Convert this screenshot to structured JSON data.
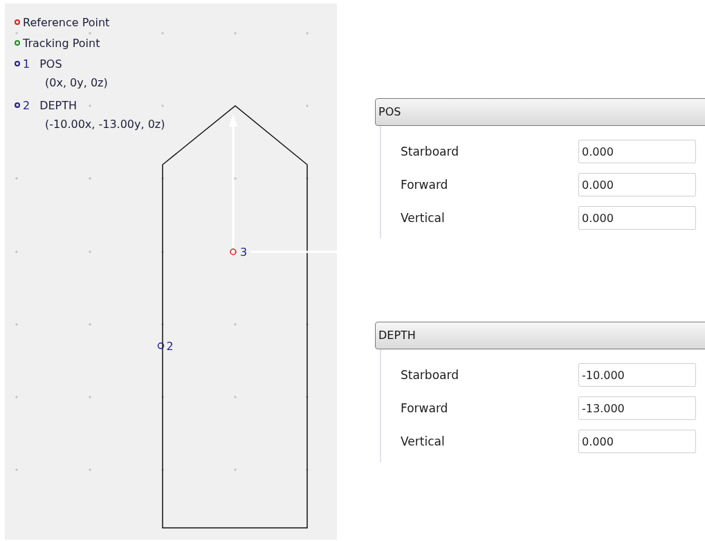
{
  "legend": [
    {
      "kind": "reference",
      "label": "Reference Point",
      "color": "#e02020"
    },
    {
      "kind": "tracking",
      "label": "Tracking Point",
      "color": "#209020"
    },
    {
      "kind": "point",
      "number": "1",
      "label": "POS",
      "coords": "(0x, 0y, 0z)",
      "color": "#20208c"
    },
    {
      "kind": "point",
      "number": "2",
      "label": "DEPTH",
      "coords": "(-10.00x, -13.00y, 0z)",
      "color": "#20208c"
    }
  ],
  "canvas": {
    "reference_marker": {
      "label": "3",
      "color": "#e02020"
    }
  },
  "panels": [
    {
      "title": "POS",
      "fields": [
        {
          "label": "Starboard",
          "value": "0.000"
        },
        {
          "label": "Forward",
          "value": "0.000"
        },
        {
          "label": "Vertical",
          "value": "0.000"
        }
      ]
    },
    {
      "title": "DEPTH",
      "marker_label": "2",
      "fields": [
        {
          "label": "Starboard",
          "value": "-10.000"
        },
        {
          "label": "Forward",
          "value": "-13.000"
        },
        {
          "label": "Vertical",
          "value": "0.000"
        }
      ]
    }
  ]
}
